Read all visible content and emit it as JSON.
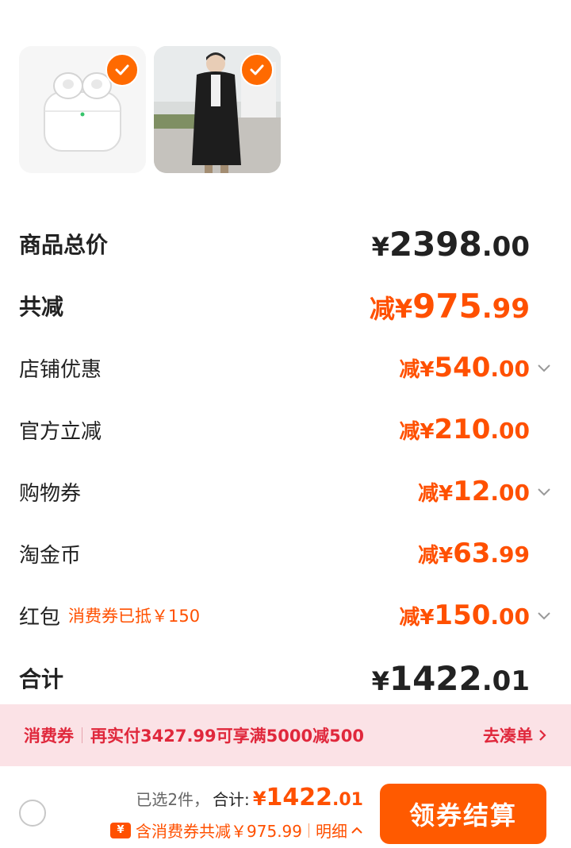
{
  "products": [
    {
      "name": "airpods-thumbnail",
      "selected": true
    },
    {
      "name": "down-coat-thumbnail",
      "selected": true
    }
  ],
  "summary": {
    "total": {
      "label": "商品总价",
      "prefix": "¥",
      "int": "2398",
      "dec": ".00"
    },
    "discount": {
      "label": "共减",
      "prefix": "减¥",
      "int": "975",
      "dec": ".99"
    },
    "items": [
      {
        "label": "店铺优惠",
        "prefix": "减¥",
        "int": "540",
        "dec": ".00",
        "expandable": true
      },
      {
        "label": "官方立减",
        "prefix": "减¥",
        "int": "210",
        "dec": ".00",
        "expandable": false
      },
      {
        "label": "购物券",
        "prefix": "减¥",
        "int": "12",
        "dec": ".00",
        "expandable": true
      },
      {
        "label": "淘金币",
        "prefix": "减¥",
        "int": "63",
        "dec": ".99",
        "expandable": false
      },
      {
        "label": "红包",
        "sub": "消费券已抵￥150",
        "prefix": "减¥",
        "int": "150",
        "dec": ".00",
        "expandable": true
      }
    ],
    "grand": {
      "label": "合计",
      "prefix": "¥",
      "int": "1422",
      "dec": ".01"
    }
  },
  "banner": {
    "tag": "消费券",
    "text": "再实付3427.99可享满5000减500",
    "action": "去凑单"
  },
  "bottom": {
    "selected": "已选2件，",
    "total_label": "合计:",
    "price_prefix": "¥",
    "price_int": "1422",
    "price_dec": ".01",
    "coupon_icon": "¥",
    "coupon_text": "含消费券共减￥975.99",
    "detail": "明细",
    "checkout": "领券结算"
  },
  "colors": {
    "accent": "#ff5000",
    "banner_bg": "#fbe2e6",
    "banner_text": "#e0283c"
  }
}
